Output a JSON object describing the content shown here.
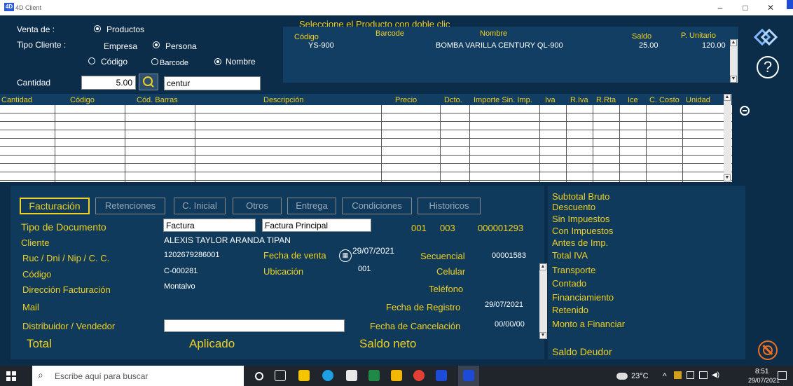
{
  "window": {
    "title": "4D Client",
    "min": "–",
    "max": "□",
    "close": "✕"
  },
  "header": {
    "venta_de_label": "Venta de :",
    "productos_label": "Productos",
    "tipo_cliente_label": "Tipo Cliente :",
    "empresa_label": "Empresa",
    "persona_label": "Persona",
    "codigo_label": "Código",
    "barcode_label": "Barcode",
    "nombre_label": "Nombre",
    "cantidad_label": "Cantidad",
    "cantidad_value": "5.00",
    "search_value": "centur",
    "instruction": "Seleccione el Producto con doble clic"
  },
  "product_list": {
    "headers": {
      "codigo": "Código",
      "barcode": "Barcode",
      "nombre": "Nombre",
      "saldo": "Saldo",
      "p_unitario": "P. Unitario"
    },
    "rows": [
      {
        "codigo": "YS-900",
        "barcode": "",
        "nombre": "BOMBA VARILLA CENTURY QL-900",
        "saldo": "25.00",
        "p_unitario": "120.00"
      }
    ]
  },
  "grid": {
    "columns": [
      "Cantidad",
      "Código",
      "Cód. Barras",
      "Descripción",
      "Precio",
      "Dcto.",
      "Importe Sin. Imp.",
      "Iva",
      "R.Iva",
      "R.Rta",
      "Ice",
      "C. Costo",
      "Unidad"
    ]
  },
  "tabs": [
    "Facturación",
    "Retenciones",
    "C. Inicial",
    "Otros",
    "Entrega",
    "Condiciones",
    "Historicos"
  ],
  "form": {
    "tipo_documento_label": "Tipo de Documento",
    "tipo_documento_value": "Factura",
    "tipo_documento_detail": "Factura Principal",
    "serie1": "001",
    "serie2": "003",
    "numero": "000001293",
    "cliente_label": "Cliente",
    "cliente_value": "ALEXIS TAYLOR  ARANDA TIPAN",
    "ruc_label": "Ruc / Dni / Nip / C. C.",
    "ruc_value": "1202679286001",
    "fecha_venta_label": "Fecha de venta",
    "fecha_venta_value": "29/07/2021",
    "secuencial_label": "Secuencial",
    "secuencial_value": "00001583",
    "codigo_label": "Código",
    "codigo_value": "C-000281",
    "ubicacion_label": "Ubicación",
    "ubicacion_value": "001",
    "celular_label": "Celular",
    "direccion_label": "Dirección Facturación",
    "direccion_value": "Montalvo",
    "telefono_label": "Teléfono",
    "mail_label": "Mail",
    "fecha_registro_label": "Fecha de Registro",
    "fecha_registro_value": "29/07/2021",
    "distribuidor_label": "Distribuidor / Vendedor",
    "fecha_cancelacion_label": "Fecha de Cancelación",
    "fecha_cancelacion_value": "00/00/00",
    "total_label": "Total",
    "aplicado_label": "Aplicado",
    "saldo_neto_label": "Saldo neto"
  },
  "summary": [
    "Subtotal Bruto",
    "Descuento",
    "Sin Impuestos",
    "Con Impuestos",
    "Antes de Imp.",
    "Total IVA",
    "Transporte",
    "Contado",
    "Financiamiento",
    "Retenido",
    "Monto a Financiar",
    "Saldo Deudor"
  ],
  "taskbar": {
    "search_placeholder": "Escribe aquí para buscar",
    "weather": "23°C",
    "time": "8:51",
    "date": "29/07/2021"
  },
  "colors": {
    "background": "#0b2d4a",
    "accent": "#f0d020",
    "panel": "#113e62"
  }
}
